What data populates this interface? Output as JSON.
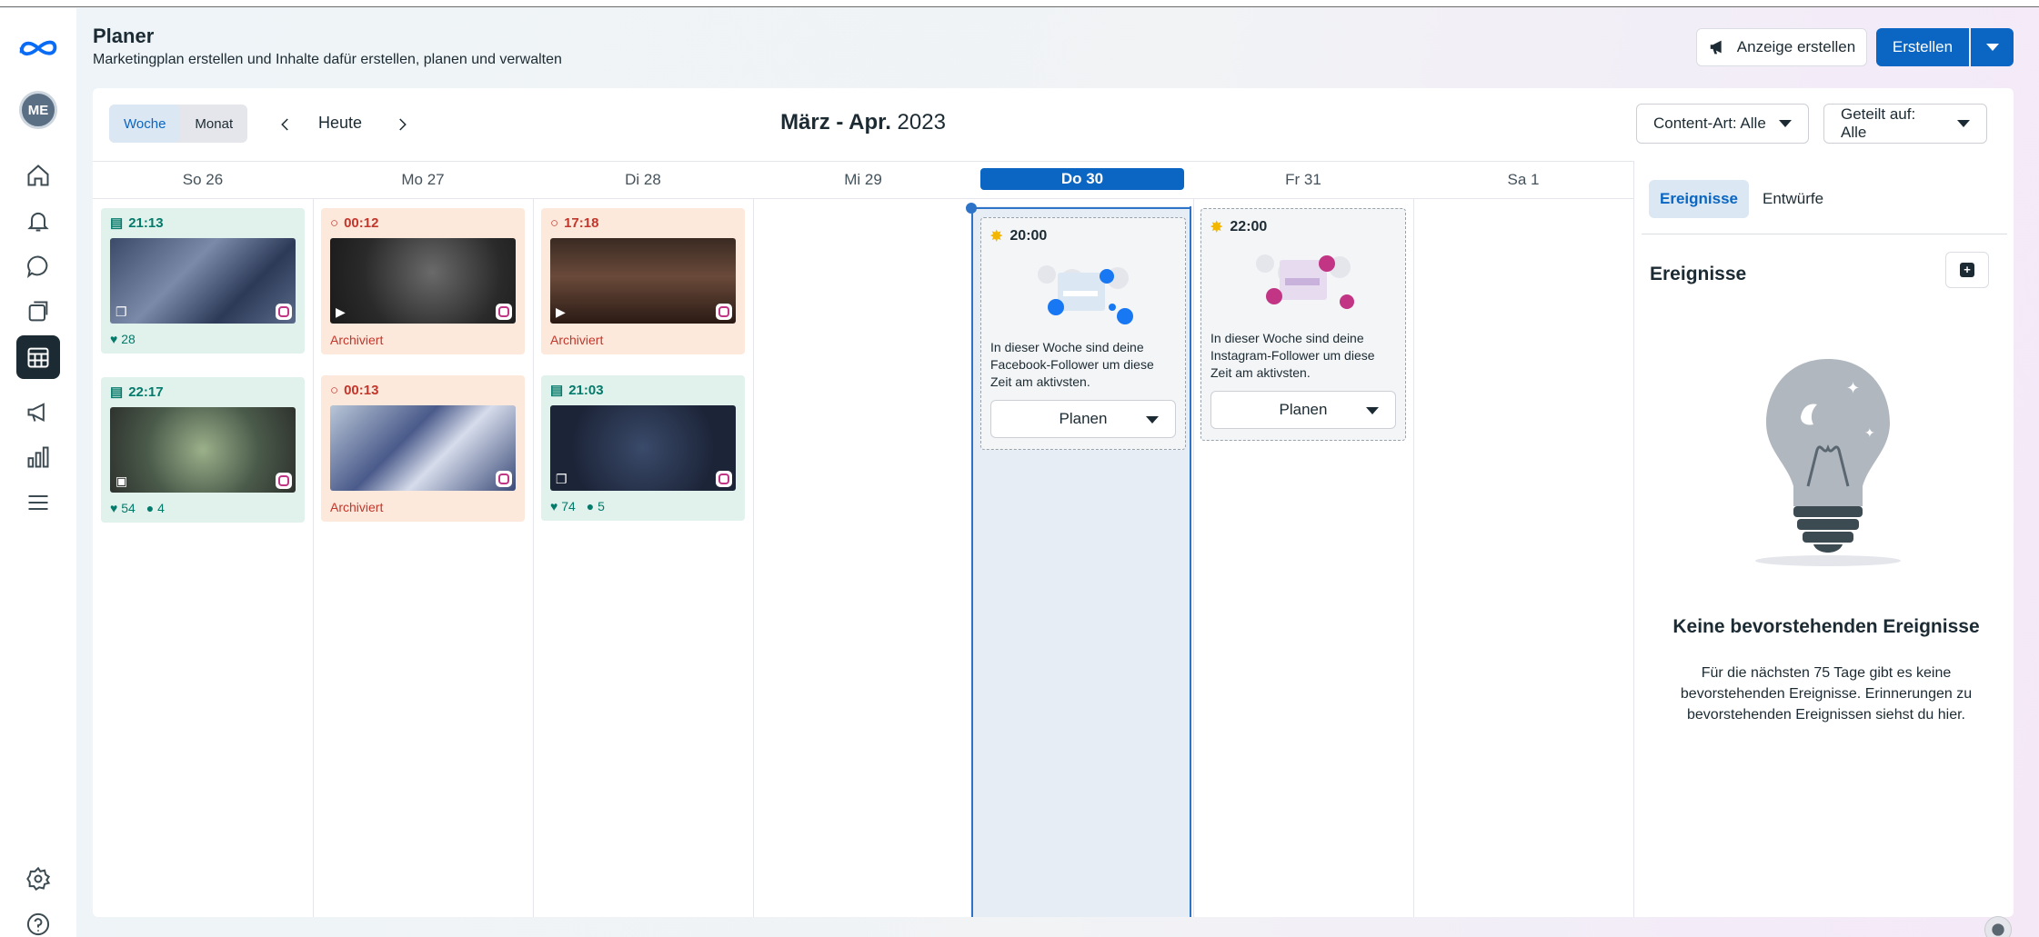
{
  "header": {
    "title": "Planer",
    "subtitle": "Marketingplan erstellen und Inhalte dafür erstellen, planen und verwalten",
    "ad_button": "Anzeige erstellen",
    "create_button": "Erstellen"
  },
  "sidebar": {
    "avatar_text": "ME",
    "items": [
      "home-icon",
      "notifications-icon",
      "inbox-icon",
      "content-icon",
      "planner-icon",
      "ads-icon",
      "insights-icon",
      "menu-icon",
      "settings-icon",
      "help-icon"
    ],
    "active": "planner-icon"
  },
  "toolbar": {
    "view_week": "Woche",
    "view_month": "Monat",
    "today": "Heute",
    "range_bold": "März - Apr.",
    "range_year": "2023",
    "filter_content": "Content-Art: Alle",
    "filter_shared": "Geteilt auf: Alle"
  },
  "days": [
    {
      "label": "So 26"
    },
    {
      "label": "Mo 27"
    },
    {
      "label": "Di 28"
    },
    {
      "label": "Mi 29"
    },
    {
      "label": "Do 30",
      "today": true
    },
    {
      "label": "Fr 31"
    },
    {
      "label": "Sa 1"
    }
  ],
  "posts": [
    {
      "day": "So 26",
      "time": "21:13",
      "state": "published",
      "likes": "28",
      "comments": ""
    },
    {
      "day": "So 26",
      "time": "22:17",
      "state": "published",
      "likes": "54",
      "comments": "4"
    },
    {
      "day": "Mo 27",
      "time": "00:12",
      "state": "archived",
      "status": "Archiviert"
    },
    {
      "day": "Mo 27",
      "time": "00:13",
      "state": "archived",
      "status": "Archiviert"
    },
    {
      "day": "Di 28",
      "time": "17:18",
      "state": "archived",
      "status": "Archiviert"
    },
    {
      "day": "Di 28",
      "time": "21:03",
      "state": "published",
      "likes": "74",
      "comments": "5"
    }
  ],
  "suggestions": [
    {
      "day": "Do 30",
      "time": "20:00",
      "text": "In dieser Woche sind deine Facebook-Follower um diese Zeit am aktivsten.",
      "button": "Planen"
    },
    {
      "day": "Fr 31",
      "time": "22:00",
      "text": "In dieser Woche sind deine Instagram-Follower um diese Zeit am aktivsten.",
      "button": "Planen"
    }
  ],
  "right_panel": {
    "tab_events": "Ereignisse",
    "tab_drafts": "Entwürfe",
    "title": "Ereignisse",
    "empty_title": "Keine bevorstehenden Ereignisse",
    "empty_text": "Für die nächsten 75 Tage gibt es keine bevorstehenden Ereignisse. Erinnerungen zu bevorstehenden Ereignissen siehst du hier."
  },
  "colors": {
    "accent": "#0a66c2",
    "published_bg": "#e1f1ec",
    "archived_bg": "#fde9dc",
    "published_text": "#047a6a",
    "archived_text": "#c3362b"
  }
}
